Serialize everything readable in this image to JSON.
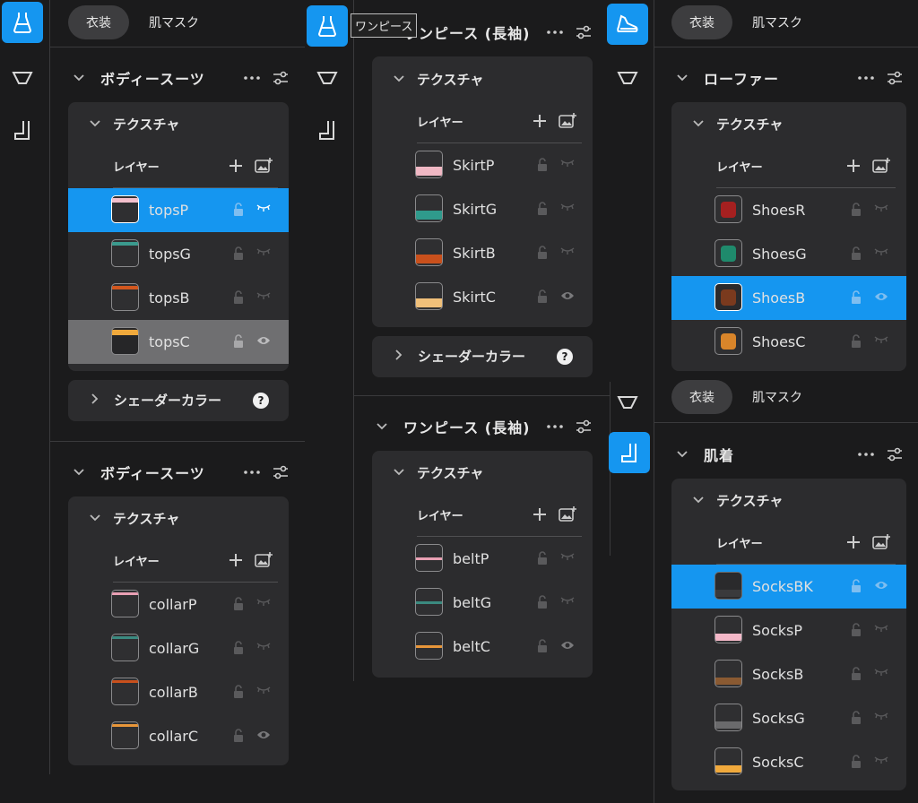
{
  "tabs": {
    "costume": "衣装",
    "skin_mask": "肌マスク"
  },
  "common": {
    "texture": "テクスチャ",
    "layer": "レイヤー",
    "shader_color": "シェーダーカラー",
    "help": "?"
  },
  "tooltip": "ワンピース",
  "panel1": {
    "section1": {
      "title": "ボディースーツ",
      "layers": [
        "topsP",
        "topsG",
        "topsB",
        "topsC"
      ]
    },
    "section2": {
      "title": "ボディースーツ",
      "layers": [
        "collarP",
        "collarG",
        "collarB",
        "collarC"
      ]
    }
  },
  "panel2": {
    "section1": {
      "title": "ワンピース (長袖)",
      "layers": [
        "SkirtP",
        "SkirtG",
        "SkirtB",
        "SkirtC"
      ]
    },
    "section2": {
      "title": "ワンピース (長袖)",
      "layers": [
        "beltP",
        "beltG",
        "beltC"
      ]
    }
  },
  "panel3": {
    "section1": {
      "title": "ローファー",
      "layers": [
        "ShoesR",
        "ShoesG",
        "ShoesB",
        "ShoesC"
      ]
    },
    "section2": {
      "title": "肌着",
      "layers": [
        "SocksBK",
        "SocksP",
        "SocksB",
        "SocksG",
        "SocksC"
      ]
    }
  },
  "icons": {
    "dress": "dress-icon",
    "underwear": "underwear-icon",
    "sock": "sock-icon",
    "shoe": "shoe-icon"
  },
  "colors": {
    "accent": "#1596f0",
    "hover": "#6f6f71",
    "card": "#2c2c2e",
    "background": "#1b1b1c"
  }
}
